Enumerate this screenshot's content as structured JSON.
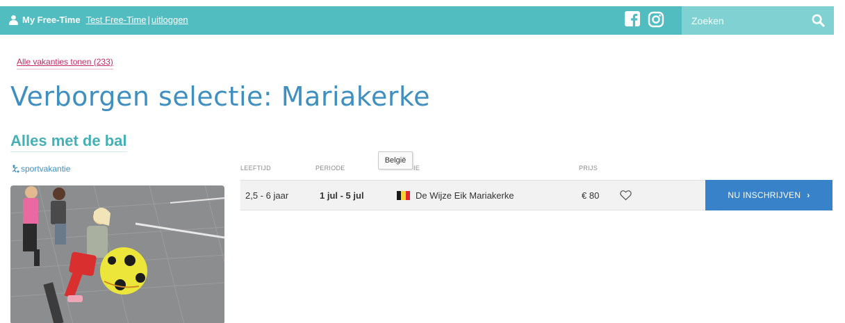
{
  "header": {
    "user_icon": "user-icon",
    "site_title": "My Free-Time",
    "account_link": "Test Free-Time",
    "separator": "|",
    "logout_link": "uitloggen",
    "facebook_icon": "facebook-icon",
    "instagram_icon": "instagram-icon",
    "search": {
      "placeholder": "Zoeken",
      "icon": "search-icon"
    }
  },
  "main": {
    "show_all_link": "Alle vakanties tonen (233)",
    "page_title": "Verborgen selectie: Mariakerke",
    "section_title": "Alles met de bal",
    "category": {
      "icon": "sport-icon",
      "label": "sportvakantie"
    },
    "photo_alt": "Kinderen spelen met een grote gele bal"
  },
  "table": {
    "headers": [
      "LEEFTIJD",
      "PERIODE",
      "IE",
      "PRIJS"
    ],
    "tooltip": "België",
    "rows": [
      {
        "age": "2,5 - 6 jaar",
        "period": "1 jul - 5 jul",
        "flag_icon": "belgium-flag-icon",
        "location": "De Wijze Eik Mariakerke",
        "price": "€ 80",
        "favorite_icon": "heart-icon",
        "cta_label": "NU INSCHRIJVEN",
        "cta_icon": "›"
      }
    ]
  },
  "colors": {
    "topbar": "#52bdc0",
    "search_bg": "#7fd1d2",
    "title_blue": "#3f8fc1",
    "section_teal": "#45b0b3",
    "link_pink": "#c32965",
    "cta_blue": "#3782c9"
  }
}
